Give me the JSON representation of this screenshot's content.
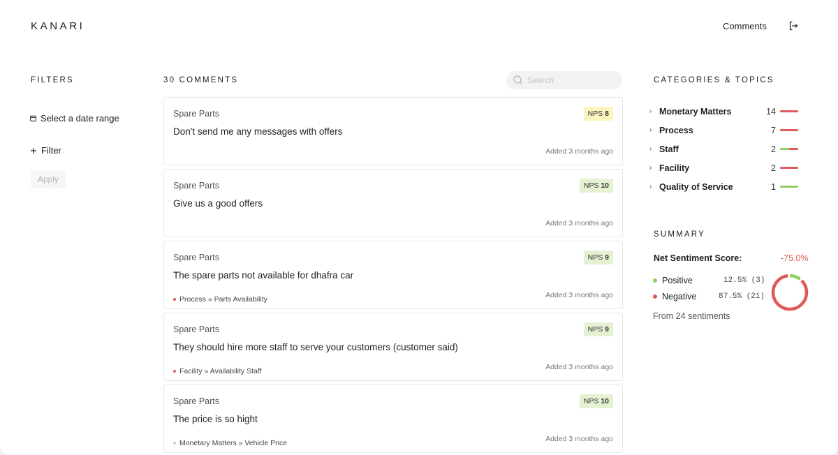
{
  "app": {
    "logo": "KANARI"
  },
  "header": {
    "nav_comments": "Comments"
  },
  "filters": {
    "title": "FILTERS",
    "date_range": "Select a date range",
    "add_filter": "Filter",
    "apply": "Apply"
  },
  "comments": {
    "count_label": "30 COMMENTS",
    "search_placeholder": "Search",
    "items": [
      {
        "category": "Spare Parts",
        "nps_label": "NPS",
        "nps": "8",
        "nps_type": "passive",
        "text": "Don't send me any messages with offers",
        "topic": "",
        "added": "Added 3 months ago"
      },
      {
        "category": "Spare Parts",
        "nps_label": "NPS",
        "nps": "10",
        "nps_type": "promoter",
        "text": "Give us a good offers",
        "topic": "",
        "added": "Added 3 months ago"
      },
      {
        "category": "Spare Parts",
        "nps_label": "NPS",
        "nps": "9",
        "nps_type": "promoter",
        "text": "The spare parts not available for dhafra car",
        "topic": "Process » Parts Availability",
        "topic_color": "#e05a58",
        "added": "Added 3 months ago"
      },
      {
        "category": "Spare Parts",
        "nps_label": "NPS",
        "nps": "9",
        "nps_type": "promoter",
        "text": "They should hire more staff to serve your customers (customer said)",
        "topic": "Facility » Availability Staff",
        "topic_color": "#e05a58",
        "added": "Added 3 months ago"
      },
      {
        "category": "Spare Parts",
        "nps_label": "NPS",
        "nps": "10",
        "nps_type": "promoter",
        "text": "The price is so hight",
        "topic": "Monetary Matters » Vehicle Price",
        "topic_color": "#cfcfcf",
        "added": "Added 3 months ago"
      }
    ]
  },
  "categories": {
    "title": "CATEGORIES & TOPICS",
    "items": [
      {
        "name": "Monetary Matters",
        "count": "14",
        "positive_fraction": 0,
        "negative_fraction": 1
      },
      {
        "name": "Process",
        "count": "7",
        "positive_fraction": 0,
        "negative_fraction": 1
      },
      {
        "name": "Staff",
        "count": "2",
        "positive_fraction": 0.5,
        "negative_fraction": 0.5
      },
      {
        "name": "Facility",
        "count": "2",
        "positive_fraction": 0,
        "negative_fraction": 1
      },
      {
        "name": "Quality of Service",
        "count": "1",
        "positive_fraction": 1,
        "negative_fraction": 0
      }
    ]
  },
  "summary": {
    "title": "SUMMARY",
    "nss_label": "Net Sentiment Score:",
    "nss_value": "-75.0%",
    "positive_label": "Positive",
    "positive_value": "12.5% (3)",
    "positive_fraction": 0.125,
    "negative_label": "Negative",
    "negative_value": "87.5% (21)",
    "negative_fraction": 0.875,
    "from_text": "From 24 sentiments"
  },
  "colors": {
    "positive": "#8ccf63",
    "negative": "#e05a58",
    "neutral_dot": "#cfcfcf",
    "nps_passive_bg": "#fbf6bf",
    "nps_promoter_bg": "#e4f1d3"
  },
  "icons": {
    "logout": "logout-icon",
    "calendar": "calendar-icon",
    "plus": "plus-icon",
    "search": "search-icon",
    "chevron": "chevron-right-icon"
  }
}
